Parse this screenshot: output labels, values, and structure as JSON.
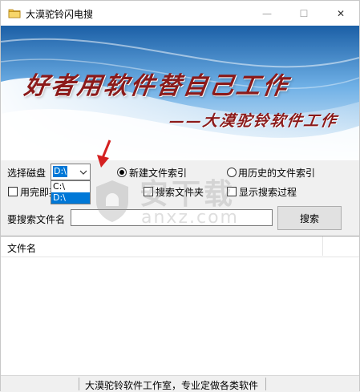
{
  "window": {
    "title": "大漠驼铃闪电搜",
    "minimize_glyph": "—",
    "maximize_glyph": "☐",
    "close_glyph": "✕"
  },
  "banner": {
    "slogan": "好者用软件替自己工作",
    "signature": "——大漠驼铃软件工作"
  },
  "disk": {
    "label": "选择磁盘",
    "selected": "D:\\",
    "options": [
      "C:\\",
      "D:\\"
    ]
  },
  "options": {
    "new_index_label": "新建文件索引",
    "history_index_label": "用历史的文件索引",
    "save_index_label": "用完即弃索引",
    "search_folder_label": "搜索文件夹",
    "show_process_label": "显示搜索过程",
    "new_index_selected": true,
    "history_index_selected": false
  },
  "search": {
    "label": "要搜索文件名",
    "value": "",
    "button_label": "搜索"
  },
  "list": {
    "columns": [
      "文件名"
    ]
  },
  "status": {
    "text": "大漠驼铃软件工作室，专业定做各类软件"
  },
  "watermark": {
    "text": "安下载",
    "sub": "anxz.com"
  },
  "icons": {
    "app": "app-icon",
    "dropdown": "chevron-down-icon",
    "annotation": "red-arrow-icon"
  },
  "colors": {
    "selection": "#0078d7",
    "banner_text": "#8b1a1a",
    "annotation_arrow": "#d42020"
  }
}
